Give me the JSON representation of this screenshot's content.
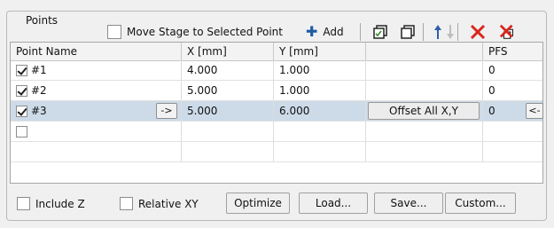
{
  "group": {
    "title": "Points"
  },
  "toolbar": {
    "move_stage_label": "Move Stage to Selected Point",
    "add_label": "Add",
    "icons": [
      "copy-icon",
      "paste-icon",
      "move-up-icon",
      "move-down-icon",
      "delete-icon",
      "delete-all-icon"
    ]
  },
  "table": {
    "headers": [
      "Point Name",
      "X [mm]",
      "Y [mm]",
      "",
      "PFS"
    ],
    "rows": [
      {
        "checked": true,
        "name": "#1",
        "x": "4.000",
        "y": "1.000",
        "action": "",
        "pfs": "0",
        "selected": false
      },
      {
        "checked": true,
        "name": "#2",
        "x": "5.000",
        "y": "1.000",
        "action": "",
        "pfs": "0",
        "selected": false
      },
      {
        "checked": true,
        "name": "#3",
        "x": "5.000",
        "y": "6.000",
        "action": "Offset All X,Y",
        "pfs": "0",
        "selected": true,
        "go_label": "->",
        "back_label": "<-"
      },
      {
        "checked": false,
        "name": "",
        "x": "",
        "y": "",
        "action": "",
        "pfs": "",
        "selected": false
      },
      {
        "checked": false,
        "name": "",
        "x": "",
        "y": "",
        "action": "",
        "pfs": "",
        "selected": false
      }
    ]
  },
  "options": {
    "include_z_label": "Include Z",
    "relative_xy_label": "Relative XY"
  },
  "buttons": {
    "optimize": "Optimize",
    "load": "Load...",
    "save": "Save...",
    "custom": "Custom..."
  }
}
